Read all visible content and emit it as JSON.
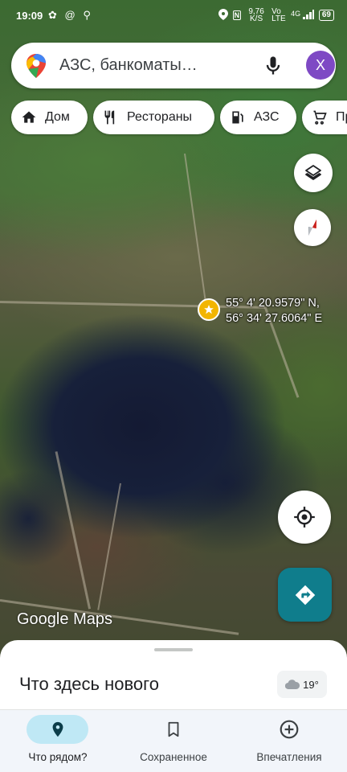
{
  "status_bar": {
    "time": "19:09",
    "left_icons": "✿ @ ⚲",
    "network_speed": "9,76 K/S",
    "volte": "Vo LTE",
    "signal": "4G",
    "battery": "69"
  },
  "search": {
    "placeholder": "АЗС, банкоматы…",
    "avatar_initial": "X"
  },
  "chips": [
    {
      "label": "Дом",
      "icon": "home-icon"
    },
    {
      "label": "Рестораны",
      "icon": "restaurant-icon"
    },
    {
      "label": "АЗС",
      "icon": "gas-station-icon"
    },
    {
      "label": "Пр",
      "icon": "cart-icon"
    }
  ],
  "map": {
    "pin_lat": "55° 4' 20.9579\" N,",
    "pin_lon": "56° 34' 27.6064\" E",
    "watermark_google": "Google",
    "watermark_maps": "Maps"
  },
  "sheet": {
    "title": "Что здесь нового",
    "temperature": "19°"
  },
  "nav": [
    {
      "label": "Что рядом?",
      "icon": "location-pin-icon",
      "active": true
    },
    {
      "label": "Сохраненное",
      "icon": "bookmark-icon",
      "active": false
    },
    {
      "label": "Впечатления",
      "icon": "add-circle-icon",
      "active": false
    }
  ],
  "colors": {
    "accent_avatar": "#7e49c4",
    "directions": "#0f7d8c",
    "nav_active": "#bfe8f5",
    "pin": "#f2b500"
  }
}
